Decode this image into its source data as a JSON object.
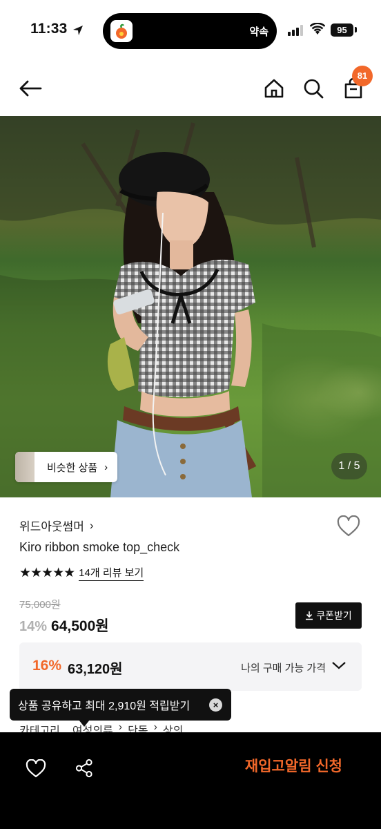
{
  "status_bar": {
    "time": "11:33",
    "island_text": "약속",
    "battery": "95"
  },
  "nav": {
    "cart_count": "81"
  },
  "hero": {
    "similar_label": "비슷한 상품",
    "chevron": "›",
    "pager": "1 / 5"
  },
  "product": {
    "brand": "위드아웃썸머",
    "brand_chevron": "›",
    "name": "Kiro ribbon smoke top_check",
    "stars": "★★★★★",
    "rating": 5,
    "review_link": "14개 리뷰 보기",
    "original_price": "75,000원",
    "discount": "14%",
    "price": "64,500원",
    "coupon_label": "쿠폰받기"
  },
  "my_price": {
    "discount": "16%",
    "price": "63,120원",
    "label": "나의 구매 가능 가격"
  },
  "tooltip": {
    "text": "상품 공유하고 최대 2,910원 적립받기",
    "close": "×"
  },
  "category": {
    "label": "카테고리",
    "crumbs": [
      "여성의류",
      "›",
      "단독",
      "›",
      "상의"
    ]
  },
  "bottom_bar": {
    "restock_label": "재입고알림 신청"
  },
  "colors": {
    "accent": "#f2682a",
    "dark": "#111111",
    "box_bg": "#f4f4f6"
  },
  "icons": [
    "location-arrow-icon",
    "signal-icon",
    "wifi-icon",
    "battery-icon",
    "back-arrow-icon",
    "home-icon",
    "search-icon",
    "cart-icon",
    "heart-icon",
    "share-icon",
    "download-icon",
    "chevron-down-icon",
    "close-icon"
  ]
}
